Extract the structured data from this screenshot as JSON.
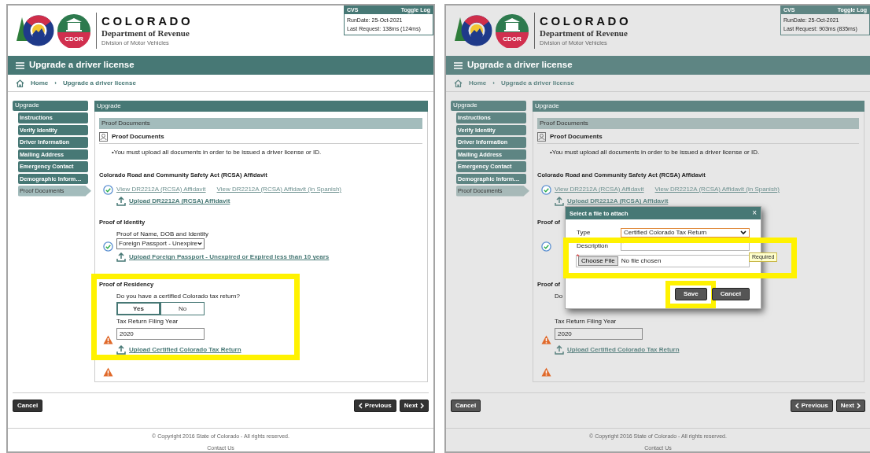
{
  "panels": [
    {
      "dimmed": false,
      "brand": {
        "state": "COLORADO",
        "department": "Department of Revenue",
        "division": "Division of Motor Vehicles",
        "badge": "CDOR"
      },
      "log": {
        "title": "CVS",
        "toggle": "Toggle Log",
        "run_date": "RunDate: 25-Oct-2021",
        "last_request": "Last Request: 138ms (124ms)"
      },
      "page_title": "Upgrade a driver license",
      "breadcrumb": [
        "Home",
        "›",
        "Upgrade a driver license"
      ],
      "sidebar": {
        "title": "Upgrade",
        "items": [
          {
            "label": "Instructions",
            "selected": false
          },
          {
            "label": "Verify Identity",
            "selected": false
          },
          {
            "label": "Driver Information",
            "selected": false
          },
          {
            "label": "Mailing Address",
            "selected": false
          },
          {
            "label": "Emergency Contact",
            "selected": false
          },
          {
            "label": "Demographic Inform…",
            "selected": false
          },
          {
            "label": "Proof Documents",
            "selected": true
          }
        ]
      },
      "main_title": "Upgrade",
      "section_bar": "Proof Documents",
      "section_heading": "Proof Documents",
      "note": "•You must upload all documents in order to be issued a driver license or ID.",
      "rcsa": {
        "heading": "Colorado Road and Community Safety Act (RCSA) Affidavit",
        "complete": true,
        "links": [
          "View DR2212A (RCSA) Affidavit",
          "View DR2212A (RCSA) Affidavit (in Spanish)"
        ],
        "upload": "Upload DR2212A (RCSA) Affidavit"
      },
      "identity": {
        "heading": "Proof of Identity",
        "complete": true,
        "label": "Proof of Name, DOB and Identity",
        "select_value": "Foreign Passport - Unexpire",
        "upload": "Upload Foreign Passport - Unexpired or Expired less than 10 years"
      },
      "residency": {
        "heading": "Proof of Residency",
        "complete": false,
        "highlighted": true,
        "question": "Do you have a certified Colorado tax return?",
        "answers": [
          {
            "label": "Yes",
            "selected": true
          },
          {
            "label": "No",
            "selected": false
          }
        ],
        "year_label": "Tax Return Filing Year",
        "year_value": "2020",
        "upload": "Upload Certified Colorado Tax Return"
      },
      "final_complete": false,
      "actions": {
        "cancel": "Cancel",
        "previous": "Previous",
        "next": "Next"
      },
      "footer": {
        "copyright": "© Copyright 2016 State of Colorado - All rights reserved.",
        "contact": "Contact Us"
      }
    },
    {
      "dimmed": true,
      "brand": {
        "state": "COLORADO",
        "department": "Department of Revenue",
        "division": "Division of Motor Vehicles",
        "badge": "CDOR"
      },
      "log": {
        "title": "CVS",
        "toggle": "Toggle Log",
        "run_date": "RunDate: 25-Oct-2021",
        "last_request": "Last Request: 903ms (835ms)"
      },
      "page_title": "Upgrade a driver license",
      "breadcrumb": [
        "Home",
        "›",
        "Upgrade a driver license"
      ],
      "sidebar": {
        "title": "Upgrade",
        "items": [
          {
            "label": "Instructions",
            "selected": false
          },
          {
            "label": "Verify Identity",
            "selected": false
          },
          {
            "label": "Driver Information",
            "selected": false
          },
          {
            "label": "Mailing Address",
            "selected": false
          },
          {
            "label": "Emergency Contact",
            "selected": false
          },
          {
            "label": "Demographic Inform…",
            "selected": false
          },
          {
            "label": "Proof Documents",
            "selected": true
          }
        ]
      },
      "main_title": "Upgrade",
      "section_bar": "Proof Documents",
      "section_heading": "Proof Documents",
      "note": "•You must upload all documents in order to be issued a driver license or ID.",
      "rcsa": {
        "heading": "Colorado Road and Community Safety Act (RCSA) Affidavit",
        "complete": true,
        "links": [
          "View DR2212A (RCSA) Affidavit",
          "View DR2212A (RCSA) Affidavit (in Spanish)"
        ],
        "upload": "Upload DR2212A (RCSA) Affidavit"
      },
      "identity": {
        "heading": "Proof of",
        "complete": true
      },
      "residency": {
        "heading": "Proof of",
        "complete": false,
        "question": "Do",
        "year_label": "Tax Return Filing Year",
        "year_value": "2020",
        "upload": "Upload Certified Colorado Tax Return"
      },
      "final_complete": false,
      "actions": {
        "cancel": "Cancel",
        "previous": "Previous",
        "next": "Next"
      },
      "footer": {
        "copyright": "© Copyright 2016 State of Colorado - All rights reserved.",
        "contact": "Contact Us"
      },
      "dialog": {
        "title": "Select a file to attach",
        "close": "×",
        "type_label": "Type",
        "type_value": "Certified Colorado Tax Return",
        "description_label": "Description",
        "required_mark": "*",
        "file_button": "Choose File",
        "file_status": "No file chosen",
        "tooltip": "Required",
        "fields_highlighted": true,
        "buttons": [
          {
            "label": "Save",
            "highlighted": true
          },
          {
            "label": "Cancel",
            "highlighted": false
          }
        ]
      }
    }
  ]
}
